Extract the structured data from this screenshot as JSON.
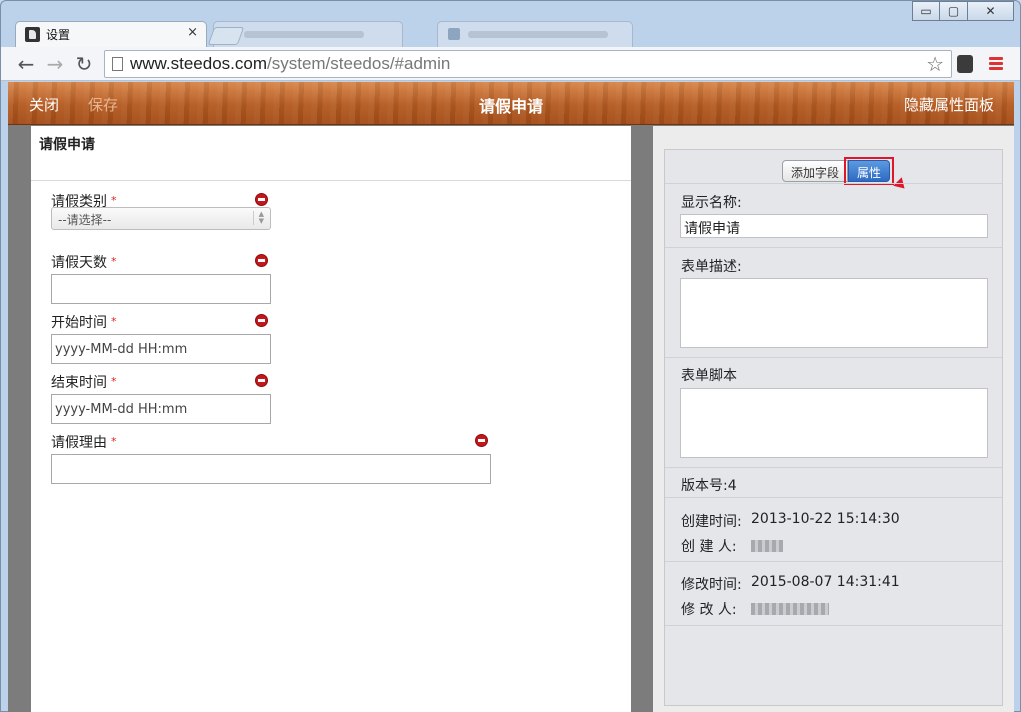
{
  "browser": {
    "tab_title": "设置",
    "tab_close": "×",
    "url_host": "www.steedos.com",
    "url_path": "/system/steedos/#admin",
    "window_buttons": {
      "minimize": "▭",
      "maximize": "▢",
      "close": "✕"
    }
  },
  "appbar": {
    "close_label": "关闭",
    "save_label": "保存",
    "title": "请假申请",
    "hide_panel_label": "隐藏属性面板"
  },
  "form": {
    "title": "请假申请",
    "required_mark": "*",
    "fields": [
      {
        "label": "请假类别",
        "type": "select",
        "value": "--请选择--"
      },
      {
        "label": "请假天数",
        "type": "text",
        "placeholder": ""
      },
      {
        "label": "开始时间",
        "type": "datetime",
        "placeholder": "yyyy-MM-dd HH:mm"
      },
      {
        "label": "结束时间",
        "type": "datetime",
        "placeholder": "yyyy-MM-dd HH:mm"
      },
      {
        "label": "请假理由",
        "type": "text",
        "placeholder": ""
      }
    ]
  },
  "panel": {
    "tabs": {
      "add_field": "添加字段",
      "properties": "属性"
    },
    "display_name_label": "显示名称:",
    "display_name_value": "请假申请",
    "description_label": "表单描述:",
    "script_label": "表单脚本",
    "version_label": "版本号:4",
    "created_time_label": "创建时间:",
    "created_time_value": "2013-10-22 15:14:30",
    "creator_label": "创 建 人:",
    "modified_time_label": "修改时间:",
    "modified_time_value": "2015-08-07 14:31:41",
    "modifier_label": "修 改 人:"
  },
  "colors": {
    "appbar_wood": "#b55b22",
    "required": "#dd2222",
    "remove_icon": "#c2171b",
    "active_tab": "#2f6ac4",
    "highlight": "#e0162b"
  }
}
